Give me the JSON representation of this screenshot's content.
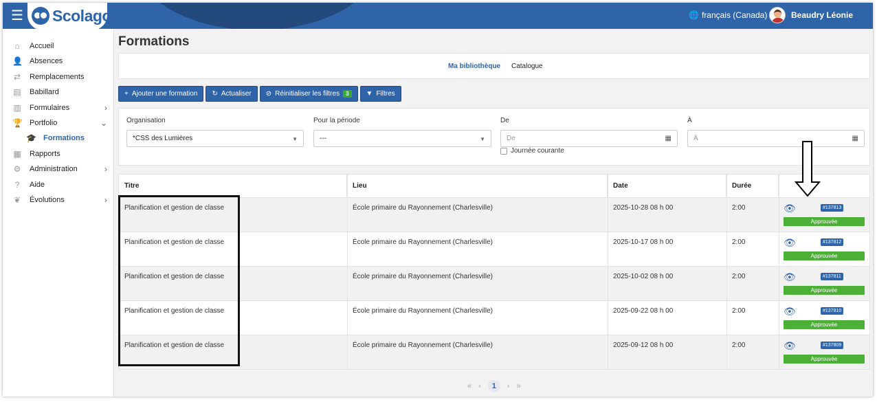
{
  "header": {
    "app_name": "Scolago",
    "language": "français (Canada)",
    "user_name": "Beaudry Léonie",
    "brand_color": "#2f64a8"
  },
  "sidebar": {
    "items": [
      {
        "label": "Accueil",
        "icon": "home-icon",
        "chevron": ""
      },
      {
        "label": "Absences",
        "icon": "user-absence-icon",
        "chevron": ""
      },
      {
        "label": "Remplacements",
        "icon": "replacement-icon",
        "chevron": ""
      },
      {
        "label": "Babillard",
        "icon": "board-icon",
        "chevron": ""
      },
      {
        "label": "Formulaires",
        "icon": "form-icon",
        "chevron": "›"
      },
      {
        "label": "Portfolio",
        "icon": "trophy-icon",
        "chevron": "⌄"
      },
      {
        "label": "Formations",
        "icon": "graduation-cap-icon",
        "chevron": ""
      },
      {
        "label": "Rapports",
        "icon": "report-icon",
        "chevron": ""
      },
      {
        "label": "Administration",
        "icon": "gear-icon",
        "chevron": "›"
      },
      {
        "label": "Aide",
        "icon": "help-icon",
        "chevron": ""
      },
      {
        "label": "Évolutions",
        "icon": "evolution-icon",
        "chevron": "›"
      }
    ]
  },
  "page": {
    "title": "Formations",
    "tabs": {
      "library": "Ma bibliothèque",
      "catalog": "Catalogue"
    }
  },
  "toolbar": {
    "add": "Ajouter une formation",
    "refresh": "Actualiser",
    "reset": "Réinitialiser les filtres",
    "reset_count": "3",
    "filters": "Filtres"
  },
  "filters": {
    "organisation_label": "Organisation",
    "organisation_value": "*CSS des Lumières",
    "period_label": "Pour la période",
    "period_value": "---",
    "from_label": "De",
    "from_placeholder": "De",
    "to_label": "À",
    "to_placeholder": "À",
    "current_day": "Journée courante"
  },
  "table": {
    "columns": [
      "Titre",
      "Lieu",
      "Date",
      "Durée",
      ""
    ],
    "rows": [
      {
        "title": "Planification et gestion de classe",
        "place": "École primaire du Rayonnement (Charlesville)",
        "date": "2025-10-28 08 h 00",
        "duration": "2:00",
        "ref": "#137813",
        "status": "Approuvée"
      },
      {
        "title": "Planification et gestion de classe",
        "place": "École primaire du Rayonnement (Charlesville)",
        "date": "2025-10-17 08 h 00",
        "duration": "2:00",
        "ref": "#137812",
        "status": "Approuvée"
      },
      {
        "title": "Planification et gestion de classe",
        "place": "École primaire du Rayonnement (Charlesville)",
        "date": "2025-10-02 08 h 00",
        "duration": "2:00",
        "ref": "#137811",
        "status": "Approuvée"
      },
      {
        "title": "Planification et gestion de classe",
        "place": "École primaire du Rayonnement (Charlesville)",
        "date": "2025-09-22 08 h 00",
        "duration": "2:00",
        "ref": "#137810",
        "status": "Approuvée"
      },
      {
        "title": "Planification et gestion de classe",
        "place": "École primaire du Rayonnement (Charlesville)",
        "date": "2025-09-12 08 h 00",
        "duration": "2:00",
        "ref": "#137809",
        "status": "Approuvée"
      }
    ]
  },
  "pagination": {
    "first": "«",
    "prev": "‹",
    "current": "1",
    "next": "›",
    "last": "»"
  }
}
